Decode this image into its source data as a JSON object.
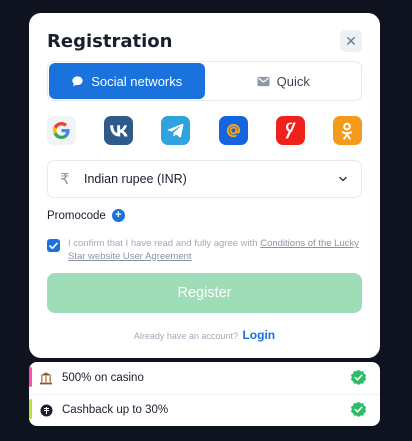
{
  "modal": {
    "title": "Registration",
    "close_icon": "close-icon"
  },
  "tabs": [
    {
      "label": "Social networks",
      "icon": "chat-bubble-icon",
      "active": true
    },
    {
      "label": "Quick",
      "icon": "envelope-icon",
      "active": false
    }
  ],
  "social": [
    {
      "name": "google",
      "icon": "google-icon",
      "bg": "#f1f3f6"
    },
    {
      "name": "vk",
      "icon": "vk-icon",
      "bg": "#2f5a8a"
    },
    {
      "name": "telegram",
      "icon": "telegram-icon",
      "bg": "#2ea3e0"
    },
    {
      "name": "mail",
      "icon": "at-icon",
      "bg": "#1565e0"
    },
    {
      "name": "yandex",
      "icon": "yandex-icon",
      "bg": "#f0201a"
    },
    {
      "name": "odnoklassniki",
      "icon": "ok-icon",
      "bg": "#f59a1b"
    }
  ],
  "currency": {
    "symbol": "₹",
    "value": "Indian rupee (INR)"
  },
  "promocode": {
    "label": "Promocode"
  },
  "agreement": {
    "checked": true,
    "text": "I confirm that I have read and fully agree with ",
    "link": "Conditions of the Lucky Star website User Agreement"
  },
  "register": {
    "label": "Register"
  },
  "footer": {
    "question": "Already have an account?",
    "login_label": "Login"
  },
  "bonuses": [
    {
      "label": "500% on casino",
      "icon": "casino-icon",
      "stripe": "#ff4fae"
    },
    {
      "label": "Cashback up to 30%",
      "icon": "cashback-icon",
      "stripe": "#b8e23a"
    }
  ],
  "colors": {
    "accent": "#1a72dc",
    "register_bg": "#9fdcb8",
    "check_green": "#2dbb6a"
  }
}
